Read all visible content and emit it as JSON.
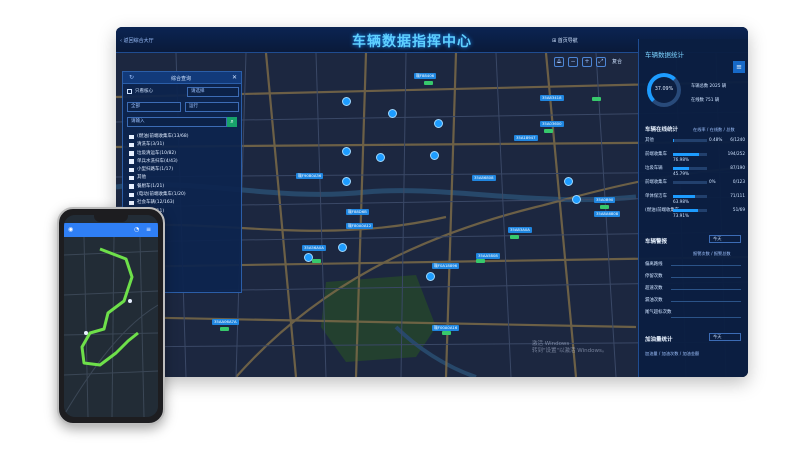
{
  "screen": {
    "back_link": "‹ 返回综合大厅",
    "title": "车辆数据指挥中心",
    "nav_button": "⊞ 首页导航",
    "reset_label": "复合"
  },
  "toolbar_icons": [
    "measure-icon",
    "zoom-out-icon",
    "zoom-in-icon",
    "fullscreen-icon"
  ],
  "query_panel": {
    "title": "综合查询",
    "close": "✕",
    "refresh": "↻",
    "only_core": "只看核心",
    "region_placeholder": "请选择",
    "type_select": "全部",
    "status_select": "运行",
    "search_placeholder": "请输入",
    "search_button": "⌕",
    "categories": [
      "(燃油)前端收集车(13/68)",
      "清洗车(3/31)",
      "垃圾清运车(10/82)",
      "单兵水洗扫车(4/43)",
      "小型扫路车(1/17)",
      "其他",
      "餐厨车(1/21)",
      "(电动)前端收集车(1/20)",
      "社会车辆(12/163)",
      "清洗车(2/11)",
      "扫路车(0/29)"
    ]
  },
  "stats": {
    "title": "车辆数据统计",
    "menu_icon": "≡",
    "donut_percent": "37.09%",
    "total": "车辆总数 2025 辆",
    "online": "在线数 751 辆",
    "online_section": "车辆在线统计",
    "online_header": "在线率 / 在线数 / 总数",
    "rows": [
      {
        "name": "其他",
        "pct": "0.48%",
        "pct2": "",
        "count": "6/1240",
        "fraction": 0.0048
      },
      {
        "name": "前端收集车",
        "pct": "",
        "pct2": "76.98%",
        "count": "194/252",
        "fraction": 0.7698
      },
      {
        "name": "垃圾车辆",
        "pct": "",
        "pct2": "45.79%",
        "count": "87/190",
        "fraction": 0.4579
      },
      {
        "name": "前端收集车",
        "pct": "0%",
        "pct2": "",
        "count": "0/123",
        "fraction": 0.0
      },
      {
        "name": "单体保洁车",
        "pct": "",
        "pct2": "63.98%",
        "count": "71/111",
        "fraction": 0.6398
      },
      {
        "name": "(燃油)前端收集车",
        "pct": "",
        "pct2": "73.91%",
        "count": "51/69",
        "fraction": 0.7391
      }
    ],
    "alarm_section": "车辆警报",
    "alarm_dropdown": "今天",
    "alarm_header": "报警次数 / 报警总数",
    "alarms": [
      "偏离路线",
      "停留次数",
      "超速次数",
      "漏油次数",
      "尾气超标次数"
    ],
    "fuel_section": "加油量统计",
    "fuel_dropdown": "今天",
    "fuel_footer": "加油量 / 加油次数 / 加油金额"
  },
  "watermark": {
    "line1": "激活 Windows",
    "line2": "转到\"设置\"以激活 Windows。"
  },
  "vehicle_tags": [
    "赣F88406",
    "35A83418",
    "35A03600",
    "35A18947",
    "赣F90B0A36",
    "35A86808",
    "35A0B90",
    "赣F88D6B",
    "赣F80A0A12",
    "35A8A6808",
    "35A83A0A",
    "35AA5808",
    "35A56A0A",
    "赣F0A18896",
    "35AA06A7A",
    "赣F00A0A16"
  ],
  "phone": {
    "header_icons": [
      "user-icon",
      "bell-icon",
      "menu-icon"
    ]
  }
}
